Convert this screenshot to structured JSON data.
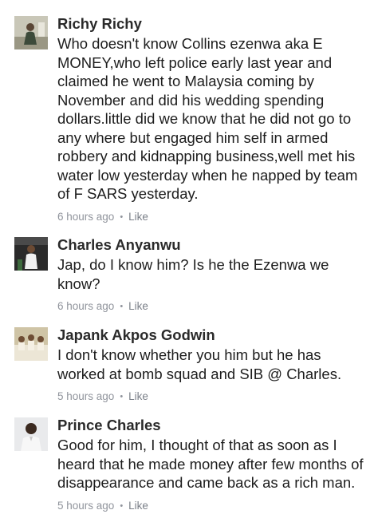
{
  "comments": [
    {
      "name": "Richy Richy",
      "text": "Who doesn't know Collins ezenwa aka E MONEY,who left police early last year and claimed he went to Malaysia coming by November and did his wedding spending dollars.little did we know that he did not go to any where but engaged him self in armed robbery and kidnapping business,well met his water low yesterday when he napped by team of F SARS yesterday.",
      "time": "6 hours ago",
      "separator": "•",
      "like": "Like"
    },
    {
      "name": "Charles Anyanwu",
      "text": "Jap, do I know him? Is he the Ezenwa we know?",
      "time": "6 hours ago",
      "separator": "•",
      "like": "Like"
    },
    {
      "name": "Japank Akpos Godwin",
      "text": "I don't know whether you him but he has worked at bomb squad and SIB @ Charles.",
      "time": "5 hours ago",
      "separator": "•",
      "like": "Like"
    },
    {
      "name": "Prince Charles",
      "text": "Good for him, I thought of that as soon as I heard that he made money after few months of disappearance and came back as a rich man.",
      "time": "5 hours ago",
      "separator": "•",
      "like": "Like"
    }
  ]
}
